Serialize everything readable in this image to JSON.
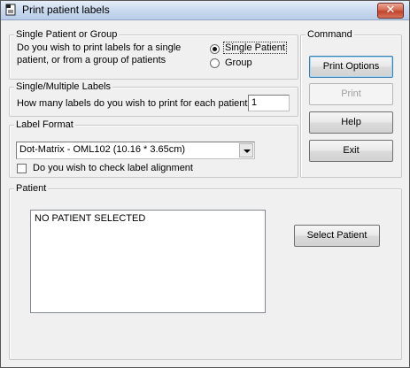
{
  "window": {
    "title": "Print patient labels",
    "close_glyph": "✕"
  },
  "patient_source": {
    "legend": "Single Patient or Group",
    "question_line1": "Do you wish to print labels for a single",
    "question_line2": "patient, or from a group of patients",
    "options": [
      {
        "label": "Single Patient",
        "selected": true
      },
      {
        "label": "Group",
        "selected": false
      }
    ]
  },
  "labels_count": {
    "legend": "Single/Multiple Labels",
    "question": "How many labels do you wish to print for each patient:",
    "value": "1"
  },
  "label_format": {
    "legend": "Label Format",
    "selected": "Dot-Matrix - OML102 (10.16 * 3.65cm)",
    "check_alignment_label": "Do you wish to check label alignment",
    "check_alignment_checked": false
  },
  "command": {
    "legend": "Command",
    "print_options": "Print Options",
    "print": "Print",
    "help": "Help",
    "exit": "Exit"
  },
  "patient": {
    "legend": "Patient",
    "list_text": "NO PATIENT SELECTED",
    "select_button": "Select Patient"
  },
  "icons": {
    "title_icon": "printer-label-icon",
    "close": "close-icon",
    "dropdown": "chevron-down-icon"
  }
}
